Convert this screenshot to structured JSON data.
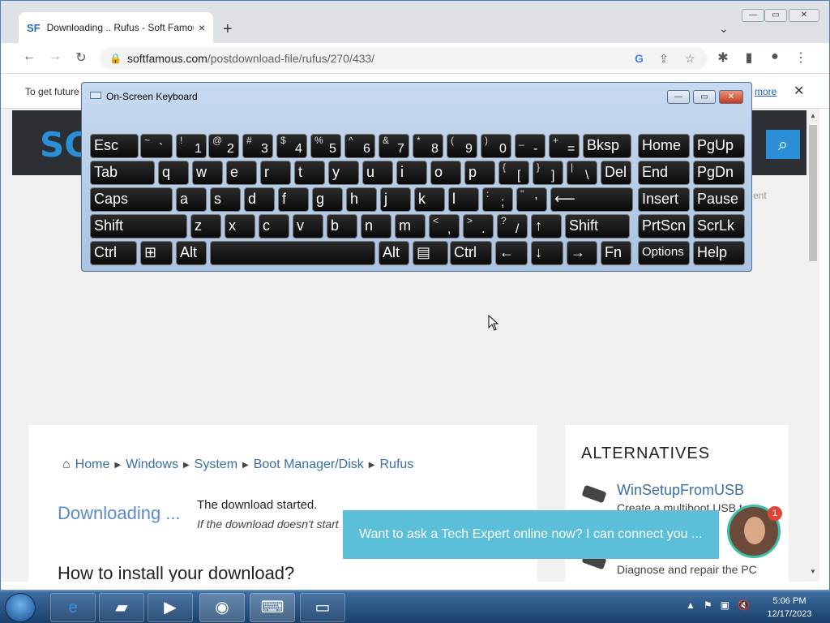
{
  "browser": {
    "tab_favicon": "SF",
    "tab_title": "Downloading .. Rufus - Soft Famous",
    "tab_close": "×",
    "new_tab": "+",
    "tab_dropdown": "⌄",
    "url_host": "softfamous.com",
    "url_path": "/postdownload-file/rufus/270/433/",
    "info_text": "To get future",
    "info_more": "more",
    "info_close": "✕"
  },
  "window_buttons": {
    "minimize": "—",
    "maximize": "▭",
    "close": "✕"
  },
  "page": {
    "logo": "SC",
    "faded": "ent",
    "breadcrumb": [
      "Home",
      "Windows",
      "System",
      "Boot Manager/Disk",
      "Rufus"
    ],
    "downloading": "Downloading ...",
    "started": "The download started.",
    "hint": "If the download doesn't start",
    "howto": "How to install your download?",
    "alternatives_heading": "ALTERNATIVES",
    "alt1_name": "WinSetupFromUSB",
    "alt1_desc": "Create a multiboot USB to",
    "alt2_desc": "Diagnose and repair the PC",
    "chat_text": "Want to ask a Tech Expert online now? I can connect you ...",
    "chat_badge": "1"
  },
  "osk": {
    "title": "On-Screen Keyboard",
    "rows": [
      [
        {
          "n": "key-esc",
          "t": "Esc"
        },
        {
          "n": "key-tilde",
          "s": "~",
          "m": "`"
        },
        {
          "n": "key-1",
          "s": "!",
          "m": "1"
        },
        {
          "n": "key-2",
          "s": "@",
          "m": "2"
        },
        {
          "n": "key-3",
          "s": "#",
          "m": "3"
        },
        {
          "n": "key-4",
          "s": "$",
          "m": "4"
        },
        {
          "n": "key-5",
          "s": "%",
          "m": "5"
        },
        {
          "n": "key-6",
          "s": "^",
          "m": "6"
        },
        {
          "n": "key-7",
          "s": "&",
          "m": "7"
        },
        {
          "n": "key-8",
          "s": "*",
          "m": "8"
        },
        {
          "n": "key-9",
          "s": "(",
          "m": "9"
        },
        {
          "n": "key-0",
          "s": ")",
          "m": "0"
        },
        {
          "n": "key-minus",
          "s": "_",
          "m": "-"
        },
        {
          "n": "key-equals",
          "s": "+",
          "m": "="
        },
        {
          "n": "key-bksp",
          "t": "Bksp"
        },
        {
          "n": "key-home",
          "t": "Home"
        },
        {
          "n": "key-pgup",
          "t": "PgUp"
        }
      ],
      [
        {
          "n": "key-tab",
          "t": "Tab"
        },
        {
          "n": "key-q",
          "t": "q"
        },
        {
          "n": "key-w",
          "t": "w"
        },
        {
          "n": "key-e",
          "t": "e"
        },
        {
          "n": "key-r",
          "t": "r"
        },
        {
          "n": "key-t",
          "t": "t"
        },
        {
          "n": "key-y",
          "t": "y"
        },
        {
          "n": "key-u",
          "t": "u"
        },
        {
          "n": "key-i",
          "t": "i"
        },
        {
          "n": "key-o",
          "t": "o"
        },
        {
          "n": "key-p",
          "t": "p"
        },
        {
          "n": "key-lbracket",
          "s": "{",
          "m": "["
        },
        {
          "n": "key-rbracket",
          "s": "}",
          "m": "]"
        },
        {
          "n": "key-backslash",
          "s": "|",
          "m": "\\"
        },
        {
          "n": "key-del",
          "t": "Del"
        },
        {
          "n": "key-end",
          "t": "End"
        },
        {
          "n": "key-pgdn",
          "t": "PgDn"
        }
      ],
      [
        {
          "n": "key-caps",
          "t": "Caps"
        },
        {
          "n": "key-a",
          "t": "a"
        },
        {
          "n": "key-s",
          "t": "s"
        },
        {
          "n": "key-d",
          "t": "d"
        },
        {
          "n": "key-f",
          "t": "f"
        },
        {
          "n": "key-g",
          "t": "g"
        },
        {
          "n": "key-h",
          "t": "h"
        },
        {
          "n": "key-j",
          "t": "j"
        },
        {
          "n": "key-k",
          "t": "k"
        },
        {
          "n": "key-l",
          "t": "l"
        },
        {
          "n": "key-semicolon",
          "s": ":",
          "m": ";"
        },
        {
          "n": "key-quote",
          "s": "\"",
          "m": "'"
        },
        {
          "n": "key-enter",
          "t": "⟵"
        },
        {
          "n": "key-insert",
          "t": "Insert"
        },
        {
          "n": "key-pause",
          "t": "Pause"
        }
      ],
      [
        {
          "n": "key-lshift",
          "t": "Shift"
        },
        {
          "n": "key-z",
          "t": "z"
        },
        {
          "n": "key-x",
          "t": "x"
        },
        {
          "n": "key-c",
          "t": "c"
        },
        {
          "n": "key-v",
          "t": "v"
        },
        {
          "n": "key-b",
          "t": "b"
        },
        {
          "n": "key-n",
          "t": "n"
        },
        {
          "n": "key-m",
          "t": "m"
        },
        {
          "n": "key-comma",
          "s": "<",
          "m": ","
        },
        {
          "n": "key-period",
          "s": ">",
          "m": "."
        },
        {
          "n": "key-slash",
          "s": "?",
          "m": "/"
        },
        {
          "n": "key-up",
          "t": "↑"
        },
        {
          "n": "key-rshift",
          "t": "Shift"
        },
        {
          "n": "key-prtscn",
          "t": "PrtScn"
        },
        {
          "n": "key-scrlk",
          "t": "ScrLk"
        }
      ],
      [
        {
          "n": "key-lctrl",
          "t": "Ctrl"
        },
        {
          "n": "key-win",
          "t": "⊞"
        },
        {
          "n": "key-lalt",
          "t": "Alt"
        },
        {
          "n": "key-space",
          "t": ""
        },
        {
          "n": "key-ralt",
          "t": "Alt"
        },
        {
          "n": "key-menu",
          "t": "▤"
        },
        {
          "n": "key-rctrl",
          "t": "Ctrl"
        },
        {
          "n": "key-left",
          "t": "←"
        },
        {
          "n": "key-down",
          "t": "↓"
        },
        {
          "n": "key-right",
          "t": "→"
        },
        {
          "n": "key-fn",
          "t": "Fn"
        },
        {
          "n": "key-options",
          "t": "Options"
        },
        {
          "n": "key-help",
          "t": "Help"
        }
      ]
    ]
  },
  "taskbar": {
    "time": "5:06 PM",
    "date": "12/17/2023"
  },
  "colors": {
    "accent": "#2a8fd6",
    "chat": "#5bbfd9",
    "link": "#3b6ea5"
  }
}
